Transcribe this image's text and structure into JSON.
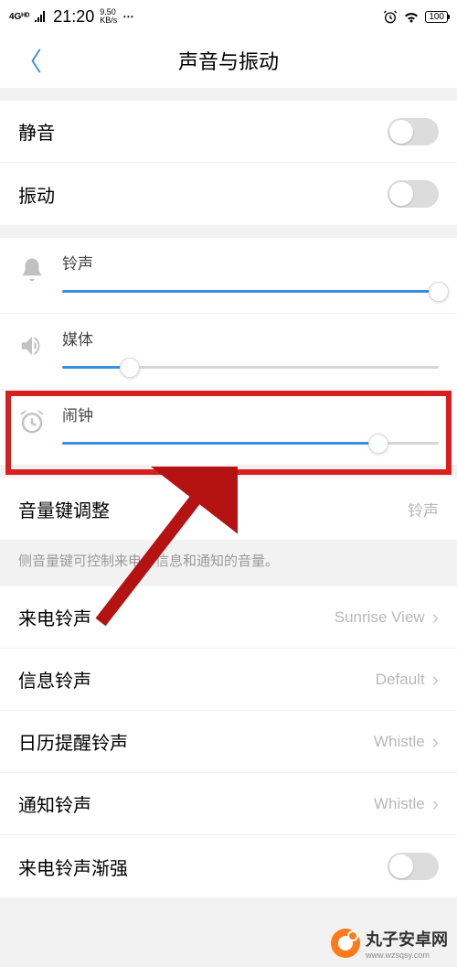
{
  "status": {
    "network": "4Gᴴᴰ",
    "time": "21:20",
    "speed_top": "9.50",
    "speed_bottom": "KB/s",
    "battery": "100"
  },
  "header": {
    "title": "声音与振动"
  },
  "toggles": {
    "mute_label": "静音",
    "vibrate_label": "振动"
  },
  "sliders": {
    "ring_label": "铃声",
    "ring_value": 100,
    "media_label": "媒体",
    "media_value": 18,
    "alarm_label": "闹钟",
    "alarm_value": 84
  },
  "volume_key": {
    "label": "音量键调整",
    "value": "铃声",
    "help": "侧音量键可控制来电、信息和通知的音量。"
  },
  "ringtones": {
    "incoming_label": "来电铃声",
    "incoming_value": "Sunrise View",
    "message_label": "信息铃声",
    "message_value": "Default",
    "calendar_label": "日历提醒铃声",
    "calendar_value": "Whistle",
    "notify_label": "通知铃声",
    "notify_value": "Whistle",
    "crescendo_label": "来电铃声渐强"
  },
  "watermark": {
    "text": "丸子安卓网",
    "url": "www.wzsqsy.com"
  }
}
